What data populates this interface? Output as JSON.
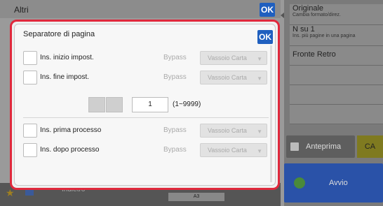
{
  "header": {
    "title": "Altri",
    "ok_label": "OK"
  },
  "right_panel": {
    "items": [
      {
        "main": "Originale",
        "sub": "Cambia formato/direz."
      },
      {
        "main": "N su 1",
        "sub": "Ins. più pagine in una pagina"
      },
      {
        "main": "Fronte Retro",
        "sub": ""
      }
    ],
    "preview_label": "Anteprima",
    "ca_label": "CA",
    "start_label": "Avvio"
  },
  "bottom_bar": {
    "back_label": "Indietro",
    "paper_label": "A3"
  },
  "dialog": {
    "title": "Separatore di pagina",
    "ok_label": "OK",
    "rows_top": [
      {
        "label": "Ins. inizio impost.",
        "bypass": "Bypass",
        "tray": "Vassoio Carta"
      },
      {
        "label": "Ins. fine impost.",
        "bypass": "Bypass",
        "tray": "Vassoio Carta"
      }
    ],
    "quantity": {
      "value": "1",
      "range": "(1~9999)"
    },
    "rows_bottom": [
      {
        "label": "Ins. prima processo",
        "bypass": "Bypass",
        "tray": "Vassoio Carta"
      },
      {
        "label": "Ins. dopo processo",
        "bypass": "Bypass",
        "tray": "Vassoio Carta"
      }
    ]
  },
  "colors": {
    "accent_red": "#e0283c",
    "ok_blue": "#1f5fbf",
    "start_blue": "#2a52a8"
  }
}
